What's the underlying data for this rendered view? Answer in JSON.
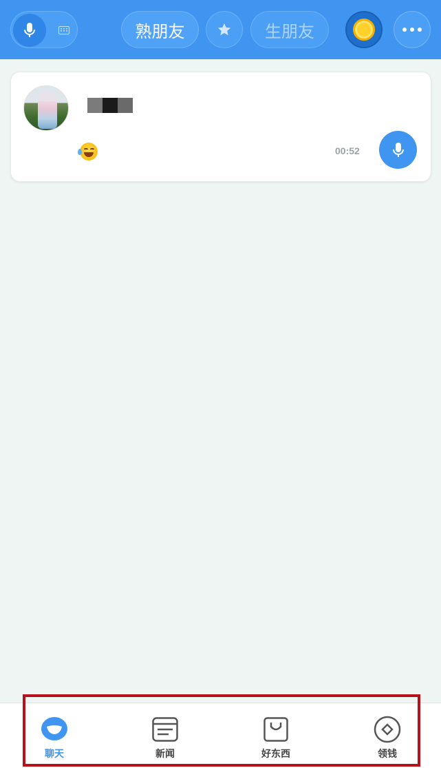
{
  "header": {
    "familiar_friends_label": "熟朋友",
    "strangers_label": "生朋友",
    "mode_toggle_icons": [
      "microphone-icon",
      "keyboard-icon"
    ],
    "star_icon": "star-icon",
    "coin_icon": "gold-coin-icon",
    "more_icon": "more-dots-icon"
  },
  "message_card": {
    "avatar_icon": "avatar-photo",
    "name": "",
    "emoji": "😭",
    "duration": "00:52",
    "play_icon": "microphone-icon"
  },
  "tabbar": {
    "items": [
      {
        "label": "聊天",
        "icon": "chat-bubble-icon",
        "active": true
      },
      {
        "label": "新闻",
        "icon": "news-icon",
        "active": false
      },
      {
        "label": "好东西",
        "icon": "shopping-bag-icon",
        "active": false
      },
      {
        "label": "领钱",
        "icon": "diamond-coin-icon",
        "active": false
      }
    ]
  },
  "colors": {
    "primary": "#3f95f0",
    "background": "#eef5f2",
    "highlight_border": "#b5121b"
  }
}
